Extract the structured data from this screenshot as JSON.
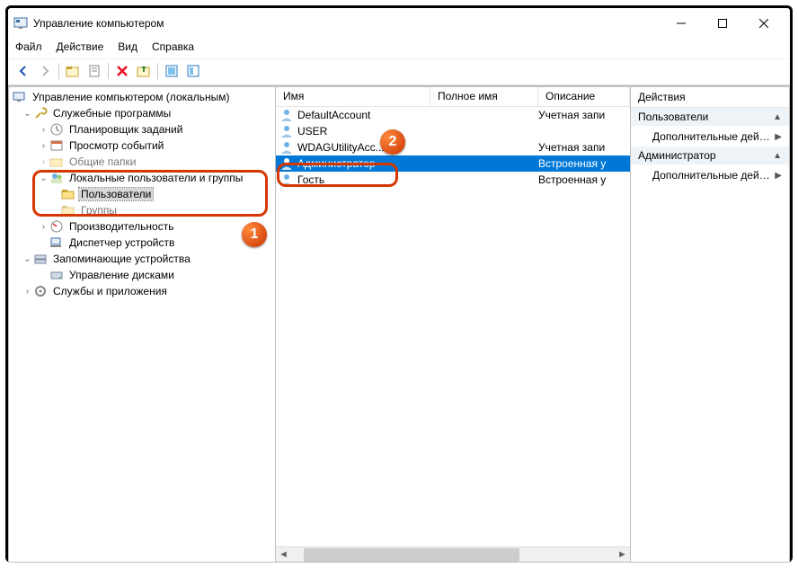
{
  "window": {
    "title": "Управление компьютером"
  },
  "menu": {
    "file": "Файл",
    "action": "Действие",
    "view": "Вид",
    "help": "Справка"
  },
  "tree": {
    "root": "Управление компьютером (локальным)",
    "utilities": "Служебные программы",
    "scheduler": "Планировщик заданий",
    "eventviewer": "Просмотр событий",
    "sharedfolders": "Общие папки",
    "localusers": "Локальные пользователи и группы",
    "users": "Пользователи",
    "groups": "Группы",
    "performance": "Производительность",
    "devmgr": "Диспетчер устройств",
    "storage": "Запоминающие устройства",
    "diskmgr": "Управление дисками",
    "services": "Службы и приложения"
  },
  "list": {
    "headers": {
      "name": "Имя",
      "fullname": "Полное имя",
      "description": "Описание"
    },
    "rows": [
      {
        "name": "DefaultAccount",
        "full": "",
        "desc": "Учетная запи"
      },
      {
        "name": "USER",
        "full": "",
        "desc": ""
      },
      {
        "name": "WDAGUtilityAcc...",
        "full": "",
        "desc": "Учетная запи"
      },
      {
        "name": "Администратор",
        "full": "",
        "desc": "Встроенная у"
      },
      {
        "name": "Гость",
        "full": "",
        "desc": "Встроенная у"
      }
    ]
  },
  "actions": {
    "title": "Действия",
    "group1": "Пользователи",
    "group1_item": "Дополнительные дей…",
    "group2": "Администратор",
    "group2_item": "Дополнительные дей…"
  },
  "callouts": {
    "one": "1",
    "two": "2"
  }
}
